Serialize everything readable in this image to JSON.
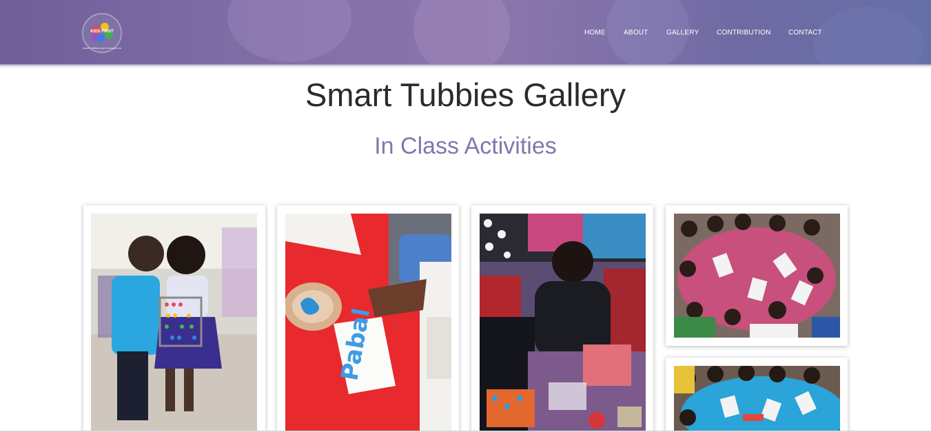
{
  "header": {
    "logo_text": "SMART TUBBIES EARLY LEARNING CENTRE",
    "logo_center_text": "KIDS FIRST"
  },
  "nav": [
    {
      "label": "HOME"
    },
    {
      "label": "ABOUT"
    },
    {
      "label": "GALLERY"
    },
    {
      "label": "CONTRIBUTION"
    },
    {
      "label": "CONTACT"
    }
  ],
  "main": {
    "page_title": "Smart Tubbies Gallery",
    "section_title": "In Class Activities",
    "photo_word": "Pabal"
  },
  "colors": {
    "header_purple": "#8471a8",
    "section_title": "#7f78ad",
    "title_text": "#2b2b2b"
  }
}
